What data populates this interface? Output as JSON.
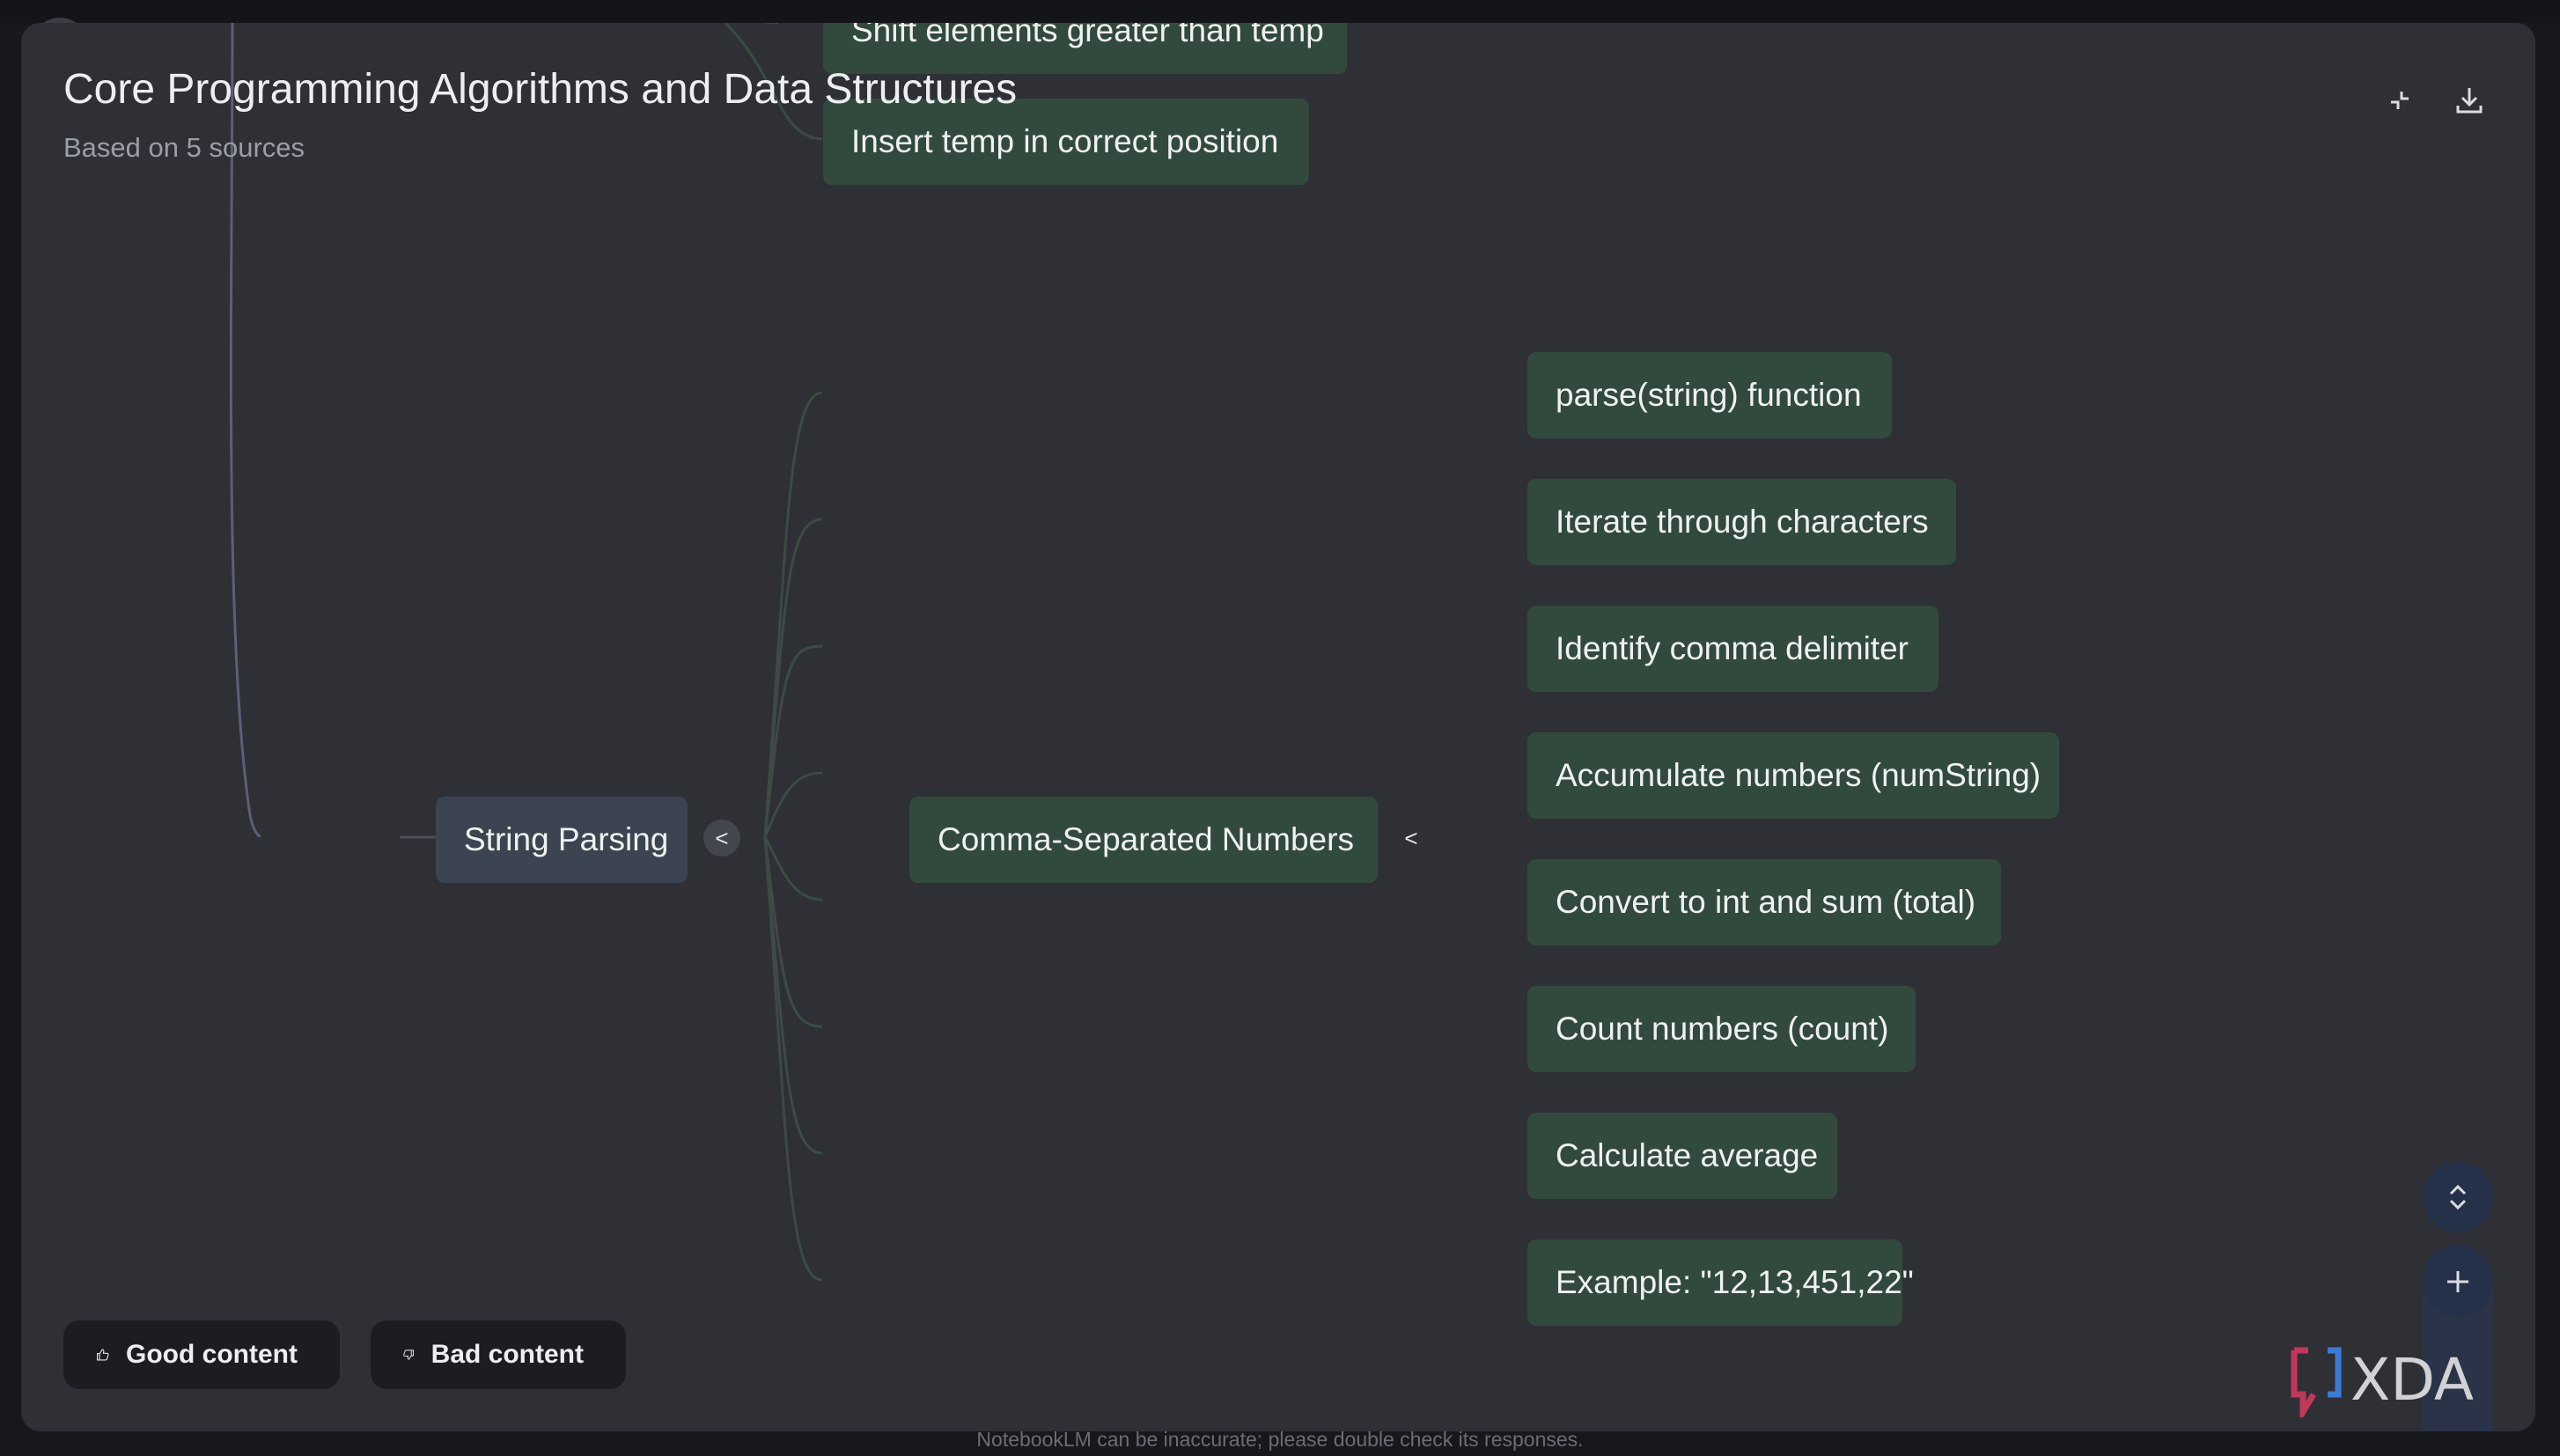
{
  "header": {
    "title": "Core Programming Algorithms and Data Structures",
    "subtitle": "Based on 5 sources"
  },
  "icons": {
    "collapse_fullscreen": "collapse-fullscreen-icon",
    "download": "download-icon",
    "thumbs_up": "thumbs-up-icon",
    "thumbs_down": "thumbs-down-icon",
    "expand_collapse_all": "unfold-icon",
    "zoom_in": "plus-icon"
  },
  "mindmap": {
    "root": {
      "label": "String Parsing",
      "toggle": "<"
    },
    "child": {
      "label": "Comma-Separated Numbers",
      "toggle": "<"
    },
    "leaves": [
      "parse(string) function",
      "Iterate through characters",
      "Identify comma delimiter",
      "Accumulate numbers (numString)",
      "Convert to int and sum (total)",
      "Count numbers (count)",
      "Calculate average",
      "Example: \"12,13,451,22\""
    ],
    "upper_nodes": [
      "Shift elements greater than temp",
      "Insert temp in correct position"
    ]
  },
  "feedback": {
    "good_label": "Good content",
    "bad_label": "Bad content"
  },
  "footer": {
    "disclaimer": "NotebookLM can be inaccurate; please double check its responses."
  },
  "watermark": "XDA",
  "colors": {
    "panel_bg": "#2e3035",
    "node_green": "#324a3e",
    "node_root": "#3b4450",
    "edge": "#3d4a45"
  }
}
